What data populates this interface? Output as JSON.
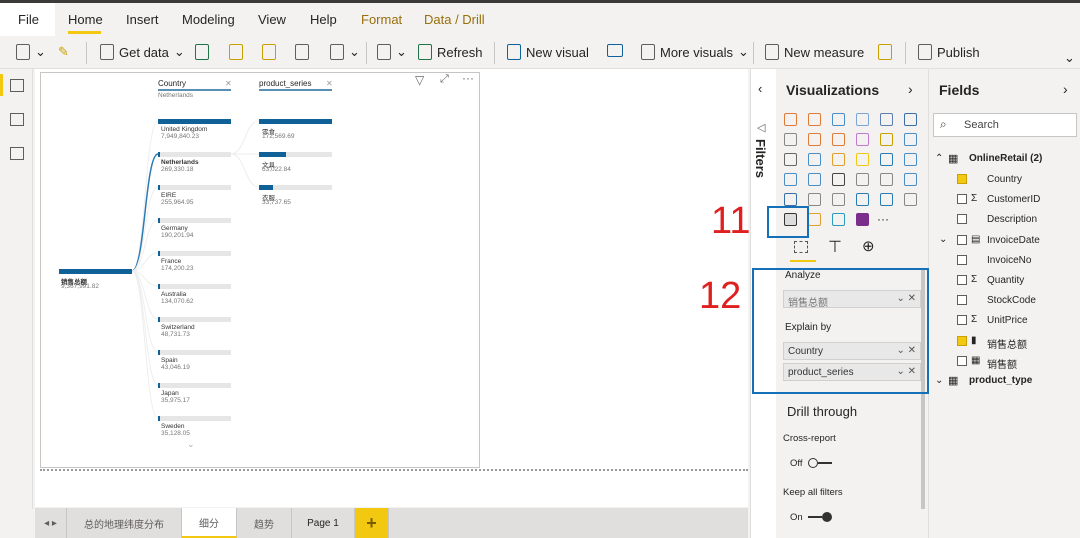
{
  "ribbon": {
    "tabs": [
      "File",
      "Home",
      "Insert",
      "Modeling",
      "View",
      "Help",
      "Format",
      "Data / Drill"
    ],
    "active": "Home"
  },
  "toolbar": {
    "get_data": "Get data",
    "refresh": "Refresh",
    "new_visual": "New visual",
    "more_visuals": "More visuals",
    "new_measure": "New measure",
    "publish": "Publish"
  },
  "visual": {
    "root": {
      "label": "销售总额",
      "value": "9,367,991.82",
      "amount": 9367991.82
    },
    "columns": [
      {
        "header": "Country",
        "subtitle": "Netherlands",
        "nodes": [
          {
            "label": "United Kingdom",
            "value": "7,949,840.23",
            "amount": 7949840.23
          },
          {
            "label": "Netherlands",
            "value": "269,330.18",
            "amount": 269330.18,
            "selected": true
          },
          {
            "label": "EIRE",
            "value": "255,964.95",
            "amount": 255964.95
          },
          {
            "label": "Germany",
            "value": "190,201.94",
            "amount": 190201.94
          },
          {
            "label": "France",
            "value": "174,200.23",
            "amount": 174200.23
          },
          {
            "label": "Australia",
            "value": "134,070.62",
            "amount": 134070.62
          },
          {
            "label": "Switzerland",
            "value": "48,731.73",
            "amount": 48731.73
          },
          {
            "label": "Spain",
            "value": "43,046.19",
            "amount": 43046.19
          },
          {
            "label": "Japan",
            "value": "35,975.17",
            "amount": 35975.17
          },
          {
            "label": "Sweden",
            "value": "35,128.05",
            "amount": 35128.05
          }
        ]
      },
      {
        "header": "product_series",
        "subtitle": "",
        "nodes": [
          {
            "label": "零食",
            "value": "172,569.69",
            "amount": 172569.69
          },
          {
            "label": "文具",
            "value": "63,022.84",
            "amount": 63022.84
          },
          {
            "label": "衣服",
            "value": "33,737.65",
            "amount": 33737.65
          }
        ]
      }
    ]
  },
  "page_tabs": [
    "总的地理纬度分布",
    "细分",
    "趋势",
    "Page 1"
  ],
  "active_page": "细分",
  "add_page": "+",
  "filters": {
    "title": "Filters"
  },
  "visualizations": {
    "title": "Visualizations",
    "analyze_label": "Analyze",
    "analyze_field": "销售总额",
    "explain_label": "Explain by",
    "explain_fields": [
      "Country",
      "product_series"
    ],
    "drill_title": "Drill through",
    "cross_report": "Cross-report",
    "cross_report_state": "Off",
    "keep_filters": "Keep all filters",
    "keep_filters_state": "On",
    "more": "···"
  },
  "fields": {
    "title": "Fields",
    "search_placeholder": "Search",
    "tables": [
      {
        "name": "OnlineRetail (2)",
        "items": [
          {
            "name": "Country",
            "checked": true,
            "type": ""
          },
          {
            "name": "CustomerID",
            "checked": false,
            "type": "Σ"
          },
          {
            "name": "Description",
            "checked": false,
            "type": ""
          },
          {
            "name": "InvoiceDate",
            "checked": false,
            "type": "cal"
          },
          {
            "name": "InvoiceNo",
            "checked": false,
            "type": ""
          },
          {
            "name": "Quantity",
            "checked": false,
            "type": "Σ"
          },
          {
            "name": "StockCode",
            "checked": false,
            "type": ""
          },
          {
            "name": "UnitPrice",
            "checked": false,
            "type": "Σ"
          },
          {
            "name": "销售总额",
            "checked": true,
            "type": "measure"
          },
          {
            "name": "销售额",
            "checked": false,
            "type": "table"
          }
        ]
      },
      {
        "name": "product_type",
        "items": []
      }
    ]
  },
  "annotations": [
    "11",
    "12"
  ],
  "colors": {
    "accent": "#f2c811",
    "bar": "#0f6198",
    "annotation": "#e02020",
    "highlight_box": "#1570b8"
  }
}
